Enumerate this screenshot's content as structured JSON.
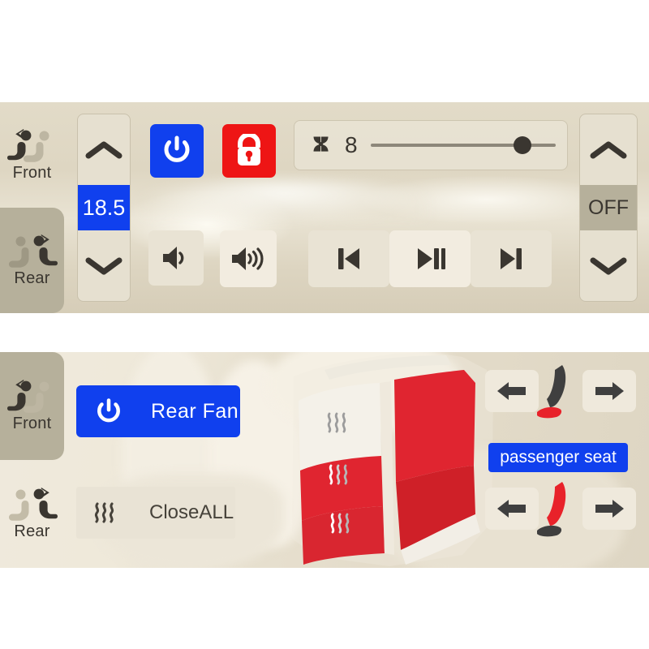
{
  "theme": {
    "panel_bg": "#ded7c4",
    "button_bg": "#e9e3d4",
    "button_light_bg": "#f2ece0",
    "accent_blue": "#1040ee",
    "accent_red": "#ee1515",
    "selected_tab_bg": "#b6b09b",
    "icon_dark": "#3a3630",
    "seat_red": "#e8222a",
    "text_dark": "#3a3630"
  },
  "top_panel": {
    "name": "front-climate-panel",
    "tabs": [
      {
        "label": "Front",
        "icon": "front-seat-person-icon",
        "selected": false
      },
      {
        "label": "Rear",
        "icon": "rear-seat-person-icon",
        "selected": true
      }
    ],
    "temperature": {
      "value": "18.5",
      "up_icon": "chevron-up-icon",
      "down_icon": "chevron-down-icon",
      "state": "on"
    },
    "power_button": {
      "icon": "power-icon",
      "label": "",
      "state": "on",
      "color": "#1040ee"
    },
    "lock_button": {
      "icon": "lock-icon",
      "label": "",
      "state": "locked",
      "color": "#ee1515"
    },
    "fan": {
      "icon": "fan-blade-icon",
      "level": "8",
      "slider_percent": 82,
      "min": 0,
      "max": 10
    },
    "volume_down_button": {
      "icon": "volume-low-icon"
    },
    "volume_up_button": {
      "icon": "volume-high-icon"
    },
    "media": {
      "previous": {
        "icon": "skip-previous-icon"
      },
      "play_pause": {
        "icon": "play-pause-icon",
        "active": true
      },
      "next": {
        "icon": "skip-next-icon"
      }
    },
    "right_stepper": {
      "value": "OFF",
      "up_icon": "chevron-up-icon",
      "down_icon": "chevron-down-icon",
      "state": "off"
    }
  },
  "bottom_panel": {
    "name": "rear-climate-panel",
    "tabs": [
      {
        "label": "Front",
        "icon": "front-seat-person-icon",
        "selected": true
      },
      {
        "label": "Rear",
        "icon": "rear-seat-person-icon",
        "selected": false
      }
    ],
    "rear_fan_button": {
      "label": "Rear  Fan",
      "icon": "power-icon",
      "state": "on",
      "color": "#1040ee"
    },
    "close_all_button": {
      "label": "CloseALL",
      "icon": "heat-wave-icon"
    },
    "seat_graphic": {
      "name": "rear-bench-seat-illustration",
      "heat_zones": [
        {
          "zone": "upper-backrest",
          "icon": "heat-wave-icon",
          "active": false
        },
        {
          "zone": "mid-backrest",
          "icon": "heat-wave-icon",
          "active": true
        },
        {
          "zone": "seat-cushion",
          "icon": "heat-wave-icon",
          "active": true
        }
      ]
    },
    "seat_adjust": {
      "label": "passenger seat",
      "upper": {
        "left_button": {
          "icon": "arrow-left-icon"
        },
        "right_button": {
          "icon": "arrow-right-icon"
        },
        "seat_icon": {
          "name": "seat-profile-icon",
          "backrest_color": "#3f3f3f",
          "cushion_color": "#e8222a"
        }
      },
      "lower": {
        "left_button": {
          "icon": "arrow-left-icon"
        },
        "right_button": {
          "icon": "arrow-right-icon"
        },
        "seat_icon": {
          "name": "seat-profile-icon",
          "backrest_color": "#e8222a",
          "cushion_color": "#3f3f3f"
        }
      }
    }
  }
}
